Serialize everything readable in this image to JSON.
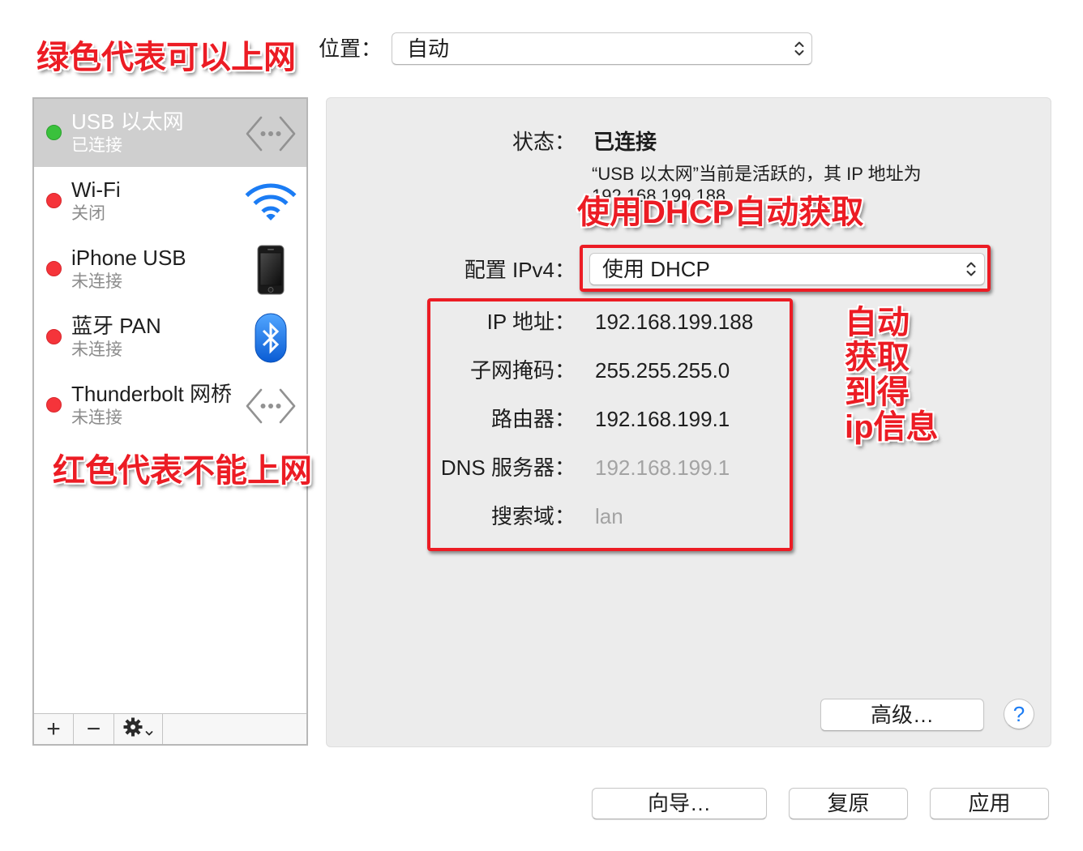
{
  "colors": {
    "annotation_red": "#ec1c24",
    "status_green": "#3ac13c",
    "status_red": "#f5343a",
    "accent_blue": "#1b7cf4"
  },
  "annotations": {
    "green_note": "绿色代表可以上网",
    "red_note": "红色代表不能上网",
    "dhcp_note": "使用DHCP自动获取",
    "ip_note": [
      "自动",
      "获取",
      "到得",
      "ip信息"
    ]
  },
  "location": {
    "label": "位置：",
    "value": "自动"
  },
  "services": [
    {
      "name": "USB 以太网",
      "status": "已连接",
      "state": "green",
      "icon": "ethernet-icon",
      "selected": true
    },
    {
      "name": "Wi-Fi",
      "status": "关闭",
      "state": "red",
      "icon": "wifi-icon",
      "selected": false
    },
    {
      "name": "iPhone USB",
      "status": "未连接",
      "state": "red",
      "icon": "iphone-icon",
      "selected": false
    },
    {
      "name": "蓝牙 PAN",
      "status": "未连接",
      "state": "red",
      "icon": "bluetooth-icon",
      "selected": false
    },
    {
      "name": "Thunderbolt 网桥",
      "status": "未连接",
      "state": "red",
      "icon": "ethernet-icon",
      "selected": false
    }
  ],
  "toolbar": {
    "add": "+",
    "remove": "−",
    "actions_icon": "gear-icon"
  },
  "detail": {
    "status_label": "状态：",
    "status_value": "已连接",
    "status_desc": "“USB 以太网”当前是活跃的，其 IP 地址为",
    "status_desc_ip": "192.168.199.188",
    "config_label": "配置 IPv4：",
    "config_value": "使用 DHCP",
    "fields": [
      {
        "label": "IP 地址：",
        "value": "192.168.199.188",
        "dimmed": false
      },
      {
        "label": "子网掩码：",
        "value": "255.255.255.0",
        "dimmed": false
      },
      {
        "label": "路由器：",
        "value": "192.168.199.1",
        "dimmed": false
      },
      {
        "label": "DNS 服务器：",
        "value": "192.168.199.1",
        "dimmed": true
      },
      {
        "label": "搜索域：",
        "value": "lan",
        "dimmed": true
      }
    ]
  },
  "buttons": {
    "advanced": "高级…",
    "help": "?",
    "assistant": "向导…",
    "revert": "复原",
    "apply": "应用"
  }
}
